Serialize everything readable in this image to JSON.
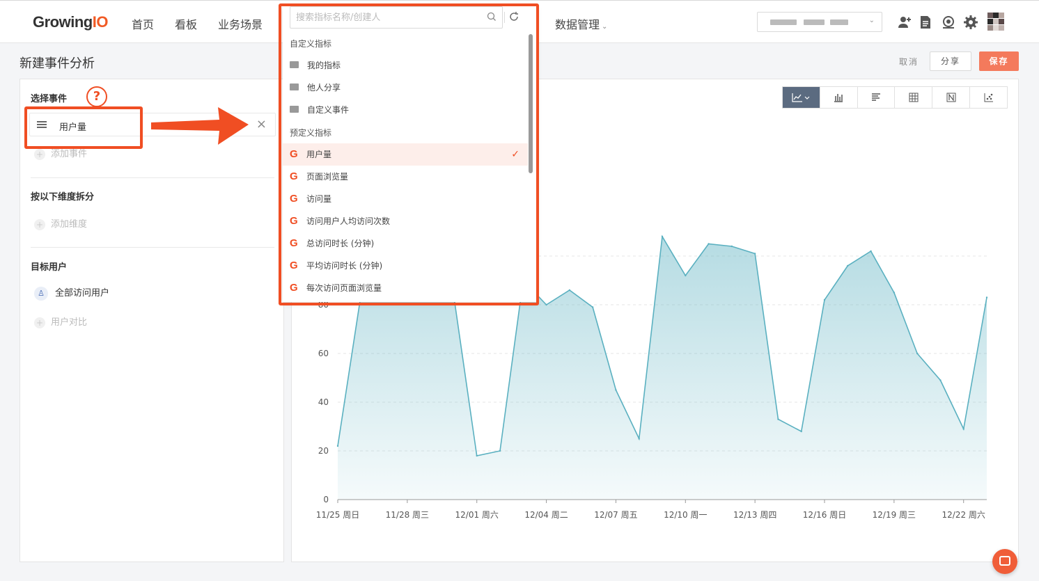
{
  "nav": {
    "logo_main": "Growing",
    "logo_io": "IO",
    "items": [
      "首页",
      "看板",
      "业务场景",
      "数据管理"
    ],
    "caret": "⌄"
  },
  "page": {
    "title": "新建事件分析",
    "cancel": "取消",
    "share": "分享",
    "save": "保存"
  },
  "left": {
    "select_event_title": "选择事件",
    "help": "?",
    "event_label": "用户量",
    "add_event": "添加事件",
    "dimension_title": "按以下维度拆分",
    "add_dimension": "添加维度",
    "target_title": "目标用户",
    "all_users": "全部访问用户",
    "compare_users": "用户对比"
  },
  "dropdown": {
    "search_placeholder": "搜索指标名称/创建人",
    "custom_header": "自定义指标",
    "folders": [
      "我的指标",
      "他人分享",
      "自定义事件"
    ],
    "predefined_header": "预定义指标",
    "items": [
      {
        "label": "用户量",
        "selected": true
      },
      {
        "label": "页面浏览量",
        "selected": false
      },
      {
        "label": "访问量",
        "selected": false
      },
      {
        "label": "访问用户人均访问次数",
        "selected": false
      },
      {
        "label": "总访问时长 (分钟)",
        "selected": false
      },
      {
        "label": "平均访问时长 (分钟)",
        "selected": false
      },
      {
        "label": "每次访问页面浏览量",
        "selected": false
      }
    ]
  },
  "chart_data": {
    "type": "area",
    "color": "#5ab0c0",
    "ylim": [
      0,
      100
    ],
    "y_ticks": [
      0,
      20,
      40,
      60,
      80
    ],
    "x_tick_labels": [
      "11/25 周日",
      "11/28 周三",
      "12/01 周六",
      "12/04 周二",
      "12/07 周五",
      "12/10 周一",
      "12/13 周四",
      "12/16 周日",
      "12/19 周三",
      "12/22 周六"
    ],
    "series": [
      {
        "values": [
          22,
          84,
          84,
          84,
          84,
          84,
          18,
          20,
          90,
          80,
          86,
          79,
          45,
          25,
          108,
          92,
          105,
          104,
          101,
          33,
          28,
          82,
          96,
          102,
          85,
          60,
          49,
          29,
          83
        ]
      }
    ]
  },
  "colors": {
    "accent": "#f04e23",
    "save_bg": "#f47a5c"
  }
}
